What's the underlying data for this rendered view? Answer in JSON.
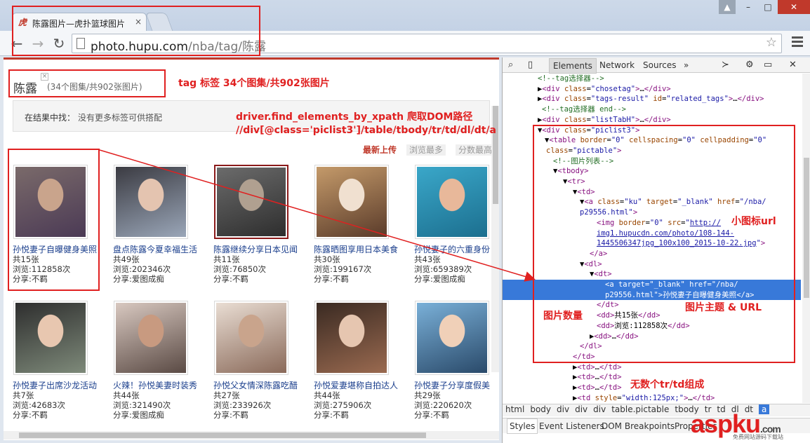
{
  "browser": {
    "tab_title": "陈露图片—虎扑篮球图片",
    "tab_close": "×",
    "favicon": "虎",
    "url_host": "photo.hupu.com",
    "url_path": "/nba/tag/陈露",
    "window_controls": [
      "▲",
      "–",
      "□",
      "✕"
    ]
  },
  "page": {
    "tag_title": "陈露",
    "tag_count": "(34个图集/共902张图片)",
    "search_label": "在结果中找：",
    "search_text": "没有更多标签可供搭配",
    "sort": [
      "最新上传",
      "浏览最多",
      "分数最高"
    ],
    "cards": [
      {
        "title": "孙悦妻子自曝健身美照",
        "count": "共15张",
        "views": "浏览:112858次",
        "share": "分享:不羁",
        "palette": [
          "#7a6a6a",
          "#c9a48c",
          "#4b3a55"
        ]
      },
      {
        "title": "盘点陈露今夏幸福生活",
        "count": "共49张",
        "views": "浏览:202346次",
        "share": "分享:爱图成痴",
        "palette": [
          "#3b3b42",
          "#e4c4b0",
          "#9aa6b8"
        ]
      },
      {
        "title": "陈露继续分享日本见闻",
        "count": "共11张",
        "views": "浏览:76850次",
        "share": "分享:不羁",
        "palette": [
          "#6b6b6b",
          "#b0a090",
          "#2e2e2e"
        ]
      },
      {
        "title": "陈露晒图享用日本美食",
        "count": "共30张",
        "views": "浏览:199167次",
        "share": "分享:不羁",
        "palette": [
          "#c49a6a",
          "#f0e0d0",
          "#5a3b2a"
        ]
      },
      {
        "title": "孙悦妻子的六重身份",
        "count": "共43张",
        "views": "浏览:659389次",
        "share": "分享:爱图成痴",
        "palette": [
          "#3aa7c9",
          "#e8b89a",
          "#1c6f8f"
        ]
      },
      {
        "title": "孙悦妻子出席沙龙活动",
        "count": "共7张",
        "views": "浏览:42683次",
        "share": "分享:不羁",
        "palette": [
          "#2e2e2e",
          "#e8c7b0",
          "#7e8a7a"
        ]
      },
      {
        "title": "火辣！孙悦美妻时装秀",
        "count": "共44张",
        "views": "浏览:321490次",
        "share": "分享:爱图成痴",
        "palette": [
          "#d8c8c0",
          "#c89a80",
          "#5a4a44"
        ]
      },
      {
        "title": "孙悦父女情深陈露吃醋",
        "count": "共27张",
        "views": "浏览:233926次",
        "share": "分享:不羁",
        "palette": [
          "#e9ddd3",
          "#c9a48c",
          "#8a6a5a"
        ]
      },
      {
        "title": "孙悦爱妻堪称自拍达人",
        "count": "共44张",
        "views": "浏览:275906次",
        "share": "分享:不羁",
        "palette": [
          "#3a2a22",
          "#e6c6b0",
          "#9a6a50"
        ]
      },
      {
        "title": "孙悦妻子分享度假美",
        "count": "共29张",
        "views": "浏览:220620次",
        "share": "分享:不羁",
        "palette": [
          "#7ab0d8",
          "#f0d0b8",
          "#2a4a6a"
        ]
      }
    ]
  },
  "devtools": {
    "tabs": [
      "Elements",
      "Network",
      "Sources",
      "»"
    ],
    "dom_lines": [
      {
        "html": "<span class=\"cmt\">&lt;!--tag选择器--&gt;</span>"
      },
      {
        "html": "▶<span class=\"tag\">&lt;div</span> <span class=\"att\">class</span>=<span class=\"val\">\"chosetag\"</span><span class=\"tag\">&gt;</span>…<span class=\"tag\">&lt;/div&gt;</span>"
      },
      {
        "html": "▶<span class=\"tag\">&lt;div</span> <span class=\"att\">class</span>=<span class=\"val\">\"tags-result\"</span> <span class=\"att\">id</span>=<span class=\"val\">\"related_tags\"</span><span class=\"tag\">&gt;</span>…<span class=\"tag\">&lt;/div&gt;</span>"
      },
      {
        "html": "<span class=\"cmt\">&lt;!--tag选择器 end--&gt;</span>"
      },
      {
        "html": "▶<span class=\"tag\">&lt;div</span> <span class=\"att\">class</span>=<span class=\"val\">\"listTabH\"</span><span class=\"tag\">&gt;</span>…<span class=\"tag\">&lt;/div&gt;</span>"
      },
      {
        "html": "▼<span class=\"tag\">&lt;div</span> <span class=\"att\">class</span>=<span class=\"val\">\"piclist3\"</span><span class=\"tag\">&gt;</span>"
      },
      {
        "html": "▼<span class=\"tag\">&lt;table</span> <span class=\"att\">border</span>=<span class=\"val\">\"0\"</span> <span class=\"att\">cellspacing</span>=<span class=\"val\">\"0\"</span> <span class=\"att\">cellpadding</span>=<span class=\"val\">\"0\"</span>"
      },
      {
        "html": "<span class=\"att\">class</span>=<span class=\"val\">\"pictable\"</span><span class=\"tag\">&gt;</span>"
      },
      {
        "html": "<span class=\"cmt\">&lt;!--图片列表--&gt;</span>"
      },
      {
        "html": "▼<span class=\"tag\">&lt;tbody&gt;</span>"
      },
      {
        "html": "▼<span class=\"tag\">&lt;tr&gt;</span>"
      },
      {
        "html": "▼<span class=\"tag\">&lt;td&gt;</span>"
      },
      {
        "html": "▼<span class=\"tag\">&lt;a</span> <span class=\"att\">class</span>=<span class=\"val\">\"ku\"</span> <span class=\"att\">target</span>=<span class=\"val\">\"_blank\"</span> <span class=\"att\">href</span>=<span class=\"val\">\"/nba/</span>"
      },
      {
        "html": "<span class=\"val\">p29556.html\"</span><span class=\"tag\">&gt;</span>"
      },
      {
        "html": "<span class=\"tag\">&lt;img</span> <span class=\"att\">border</span>=<span class=\"val\">\"0\"</span> <span class=\"att\">src</span>=<span class=\"val\">\"</span><span class=\"lnk\">http://</span>"
      },
      {
        "html": "<span class=\"lnk\">img1.hupucdn.com/photo/108-144-</span>"
      },
      {
        "html": "<span class=\"lnk\">1445506347jpg_100x100_2015-10-22.jpg</span><span class=\"val\">\"</span><span class=\"tag\">&gt;</span>"
      },
      {
        "html": "<span class=\"tag\">&lt;/a&gt;</span>"
      },
      {
        "html": "▼<span class=\"tag\">&lt;dl&gt;</span>"
      },
      {
        "html": "▼<span class=\"tag\">&lt;dt&gt;</span>"
      },
      {
        "html": "<span class=\"tag\">&lt;a</span> <span class=\"att\">target</span>=<span class=\"val\">\"_blank\"</span> <span class=\"att\">href</span>=<span class=\"val\">\"/nba/</span>"
      },
      {
        "html": "<span class=\"val\">p29556.html\"</span><span class=\"tag\">&gt;</span>孙悦妻子自曝健身美照<span class=\"tag\">&lt;/a&gt;</span>"
      },
      {
        "html": "<span class=\"tag\">&lt;/dt&gt;</span>"
      },
      {
        "html": "<span class=\"tag\">&lt;dd&gt;</span>共15张<span class=\"tag\">&lt;/dd&gt;</span>"
      },
      {
        "html": "<span class=\"tag\">&lt;dd&gt;</span>浏览:112858次<span class=\"tag\">&lt;/dd&gt;</span>"
      },
      {
        "html": "▶<span class=\"tag\">&lt;dd&gt;</span>…<span class=\"tag\">&lt;/dd&gt;</span>"
      },
      {
        "html": "<span class=\"tag\">&lt;/dl&gt;</span>"
      },
      {
        "html": "<span class=\"tag\">&lt;/td&gt;</span>"
      },
      {
        "html": "▶<span class=\"tag\">&lt;td&gt;</span>…<span class=\"tag\">&lt;/td&gt;</span>"
      },
      {
        "html": "▶<span class=\"tag\">&lt;td&gt;</span>…<span class=\"tag\">&lt;/td&gt;</span>"
      },
      {
        "html": "▶<span class=\"tag\">&lt;td&gt;</span>…<span class=\"tag\">&lt;/td&gt;</span>"
      },
      {
        "html": "▶<span class=\"tag\">&lt;td</span> <span class=\"att\">style</span>=<span class=\"val\">\"width:125px;\"</span><span class=\"tag\">&gt;</span>…<span class=\"tag\">&lt;/td&gt;</span>"
      }
    ],
    "crumbs": [
      "html",
      "body",
      "div",
      "div",
      "div",
      "table.pictable",
      "tbody",
      "tr",
      "td",
      "dl",
      "dt",
      "a"
    ],
    "subtabs": [
      "Styles",
      "Event Listeners",
      "DOM Breakpoints",
      "Properties"
    ]
  },
  "annotations": {
    "tag_label": "tag 标签   34个图集/共902张图片",
    "xpath_1": "driver.find_elements_by_xpath 爬取DOM路径",
    "xpath_2": "//div[@class='piclist3']/table/tbody/tr/td/dl/dt/a",
    "icon_url": "小图标url",
    "pic_count": "图片数量",
    "topic_url": "图片主题 & URL",
    "rows": "无数个tr/td组成"
  },
  "watermark": {
    "brand": "aspku",
    "brand_suffix": ".com",
    "tagline": "免费网站源码下载站"
  }
}
